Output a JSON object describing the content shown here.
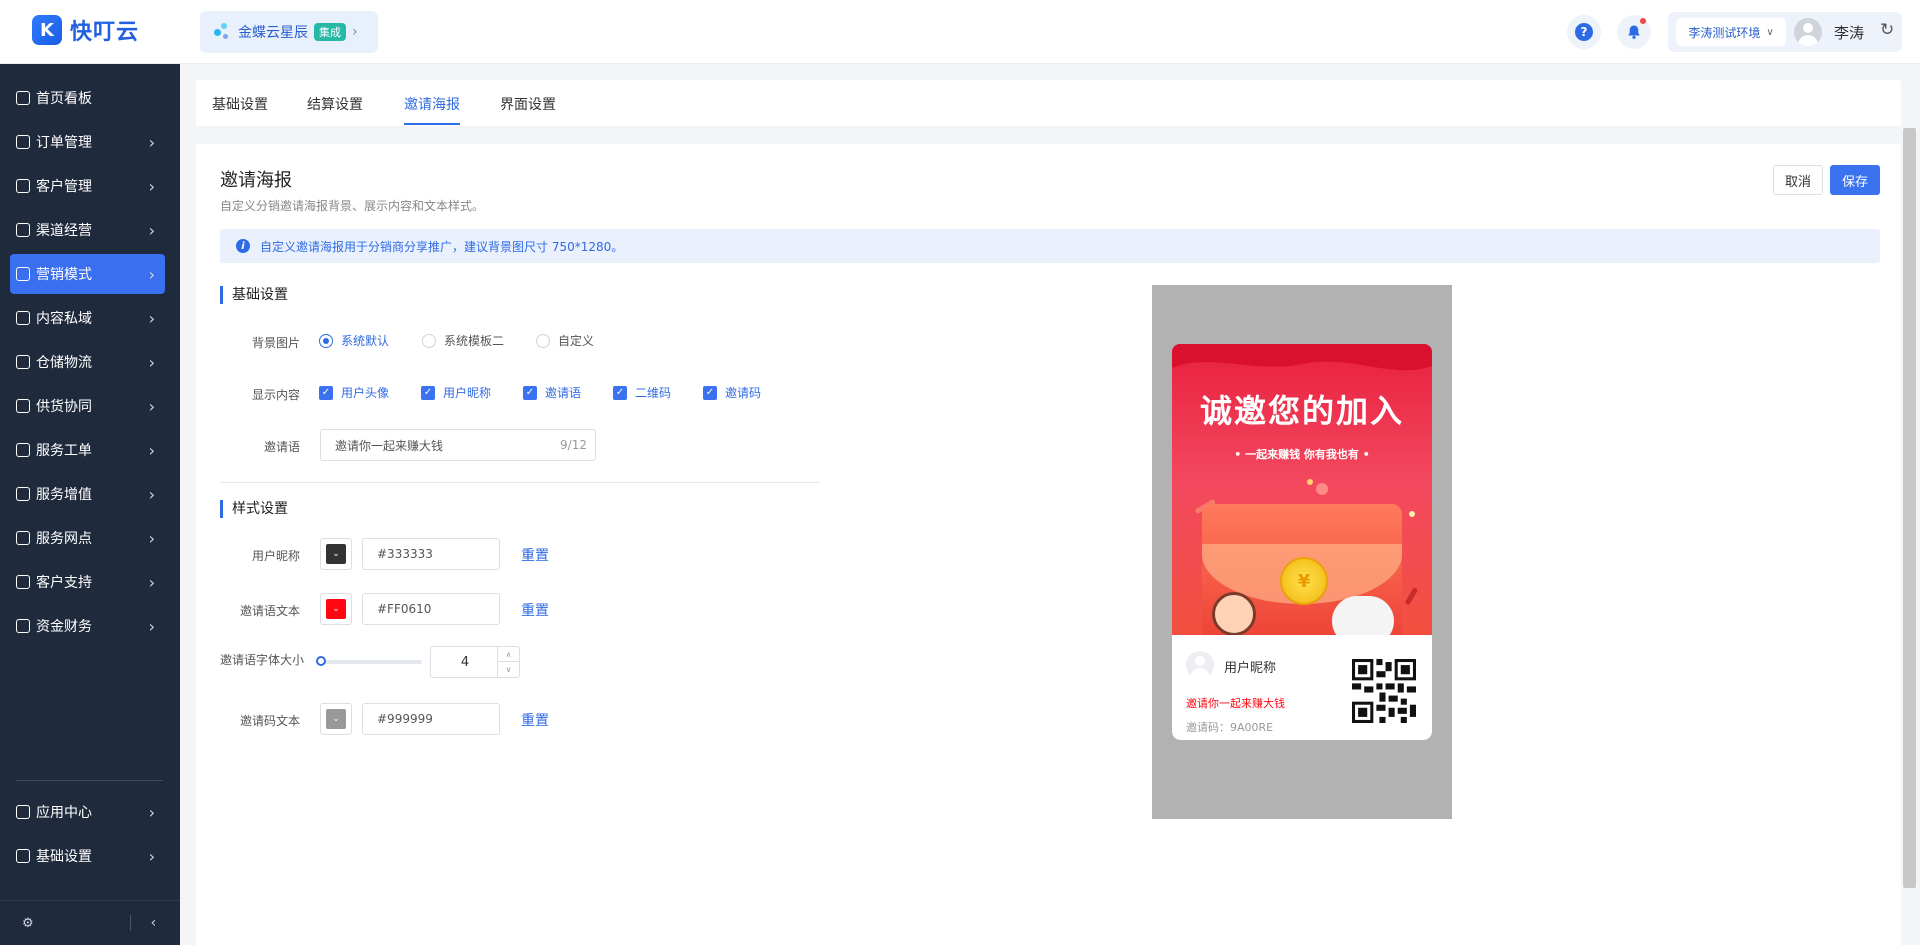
{
  "brand": {
    "name": "快叮云"
  },
  "org": {
    "name": "金蝶云星辰",
    "badge": "集成"
  },
  "header": {
    "env": "李涛测试环境",
    "user": "李涛"
  },
  "sidebar": {
    "items": [
      {
        "label": "首页看板",
        "icon": "home-icon"
      },
      {
        "label": "订单管理",
        "icon": "order-icon"
      },
      {
        "label": "客户管理",
        "icon": "user-icon"
      },
      {
        "label": "渠道经营",
        "icon": "channel-icon"
      },
      {
        "label": "营销模式",
        "icon": "tag-icon",
        "active": true
      },
      {
        "label": "内容私域",
        "icon": "image-icon"
      },
      {
        "label": "仓储物流",
        "icon": "warehouse-icon"
      },
      {
        "label": "供货协同",
        "icon": "supply-icon"
      },
      {
        "label": "服务工单",
        "icon": "ticket-icon"
      },
      {
        "label": "服务增值",
        "icon": "bag-icon"
      },
      {
        "label": "服务网点",
        "icon": "store-icon"
      },
      {
        "label": "客户支持",
        "icon": "support-icon"
      },
      {
        "label": "资金财务",
        "icon": "yen-icon"
      }
    ],
    "bottom_items": [
      {
        "label": "应用中心",
        "icon": "cube-icon"
      },
      {
        "label": "基础设置",
        "icon": "sliders-icon"
      }
    ]
  },
  "tabs": [
    {
      "label": "基础设置"
    },
    {
      "label": "结算设置"
    },
    {
      "label": "邀请海报",
      "active": true
    },
    {
      "label": "界面设置"
    }
  ],
  "page": {
    "title": "邀请海报",
    "subtitle": "自定义分销邀请海报背景、展示内容和文本样式。",
    "cancel": "取消",
    "save": "保存",
    "info": "自定义邀请海报用于分销商分享推广，建议背景图尺寸 750*1280。"
  },
  "basic": {
    "section": "基础设置",
    "bg_label": "背景图片",
    "bg_options": [
      "系统默认",
      "系统模板二",
      "自定义"
    ],
    "bg_selected": "系统默认",
    "display_label": "显示内容",
    "display_options": [
      "用户头像",
      "用户昵称",
      "邀请语",
      "二维码",
      "邀请码"
    ],
    "invite_label": "邀请语",
    "invite_value": "邀请你一起来赚大钱",
    "invite_count": "9/12"
  },
  "style": {
    "section": "样式设置",
    "nickname_label": "用户昵称",
    "nickname_color": "#333333",
    "invite_text_label": "邀请语文本",
    "invite_text_color": "#FF0610",
    "font_size_label": "邀请语字体大小",
    "font_size_value": "4",
    "code_text_label": "邀请码文本",
    "code_text_color": "#999999",
    "reset": "重置"
  },
  "poster": {
    "title": "诚邀您的加入",
    "subtitle": "• 一起来赚钱 你有我也有 •",
    "coin": "¥",
    "nickname": "用户昵称",
    "invite": "邀请你一起来赚大钱",
    "code": "邀请码：9A00RE"
  }
}
